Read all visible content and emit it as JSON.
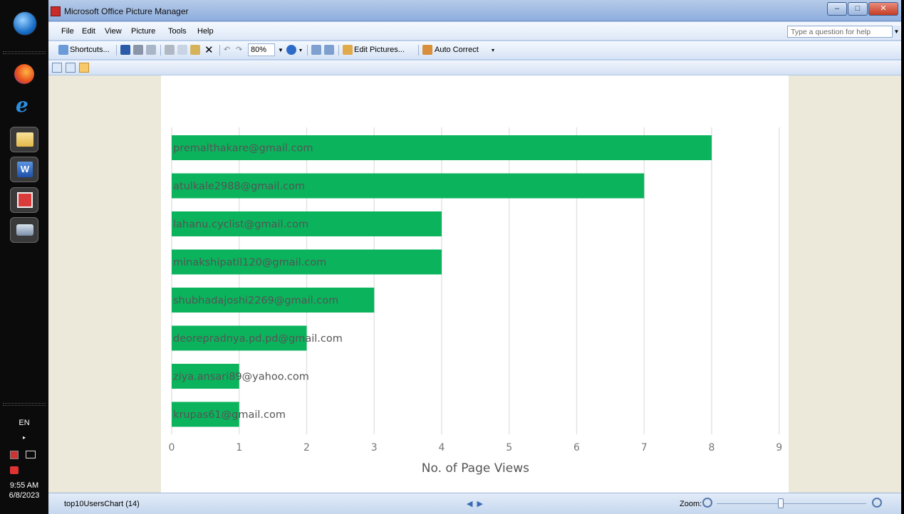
{
  "window": {
    "title": "Microsoft Office Picture Manager",
    "buttons": {
      "minimize": "–",
      "maximize": "□",
      "close": "✕"
    }
  },
  "menu": {
    "items": [
      {
        "label": "File",
        "access_key": "F"
      },
      {
        "label": "Edit",
        "access_key": "E"
      },
      {
        "label": "View",
        "access_key": "V"
      },
      {
        "label": "Picture",
        "access_key": "P"
      },
      {
        "label": "Tools",
        "access_key": "T"
      },
      {
        "label": "Help",
        "access_key": "H"
      }
    ],
    "help_placeholder": "Type a question for help"
  },
  "toolbar": {
    "shortcuts_label": "Shortcuts...",
    "zoom_value": "80%",
    "edit_pictures_label": "Edit Pictures...",
    "auto_correct_label": "Auto Correct"
  },
  "statusbar": {
    "file_name": "top10UsersChart (14)",
    "zoom_label": "Zoom:"
  },
  "taskbar": {
    "language": "EN",
    "time": "9:55 AM",
    "date": "6/8/2023"
  },
  "chart_data": {
    "type": "bar",
    "orientation": "horizontal",
    "categories": [
      "premalthakare@gmail.com",
      "atulkale2988@gmail.com",
      "lahanu.cyclist@gmail.com",
      "minakshipatil120@gmail.com",
      "shubhadajoshi2269@gmail.com",
      "deorepradnya.pd.pd@gmail.com",
      "ziya.ansari89@yahoo.com",
      "krupas61@gmail.com"
    ],
    "values": [
      8,
      7,
      4,
      4,
      3,
      2,
      1,
      1
    ],
    "xlabel": "No. of Page Views",
    "ylabel": "",
    "xlim": [
      0,
      9
    ],
    "x_ticks": [
      "0",
      "1",
      "2",
      "3",
      "4",
      "5",
      "6",
      "7",
      "8",
      "9"
    ],
    "grid": "vertical",
    "bar_color": "#0ab35c",
    "label_color": "#555555"
  }
}
